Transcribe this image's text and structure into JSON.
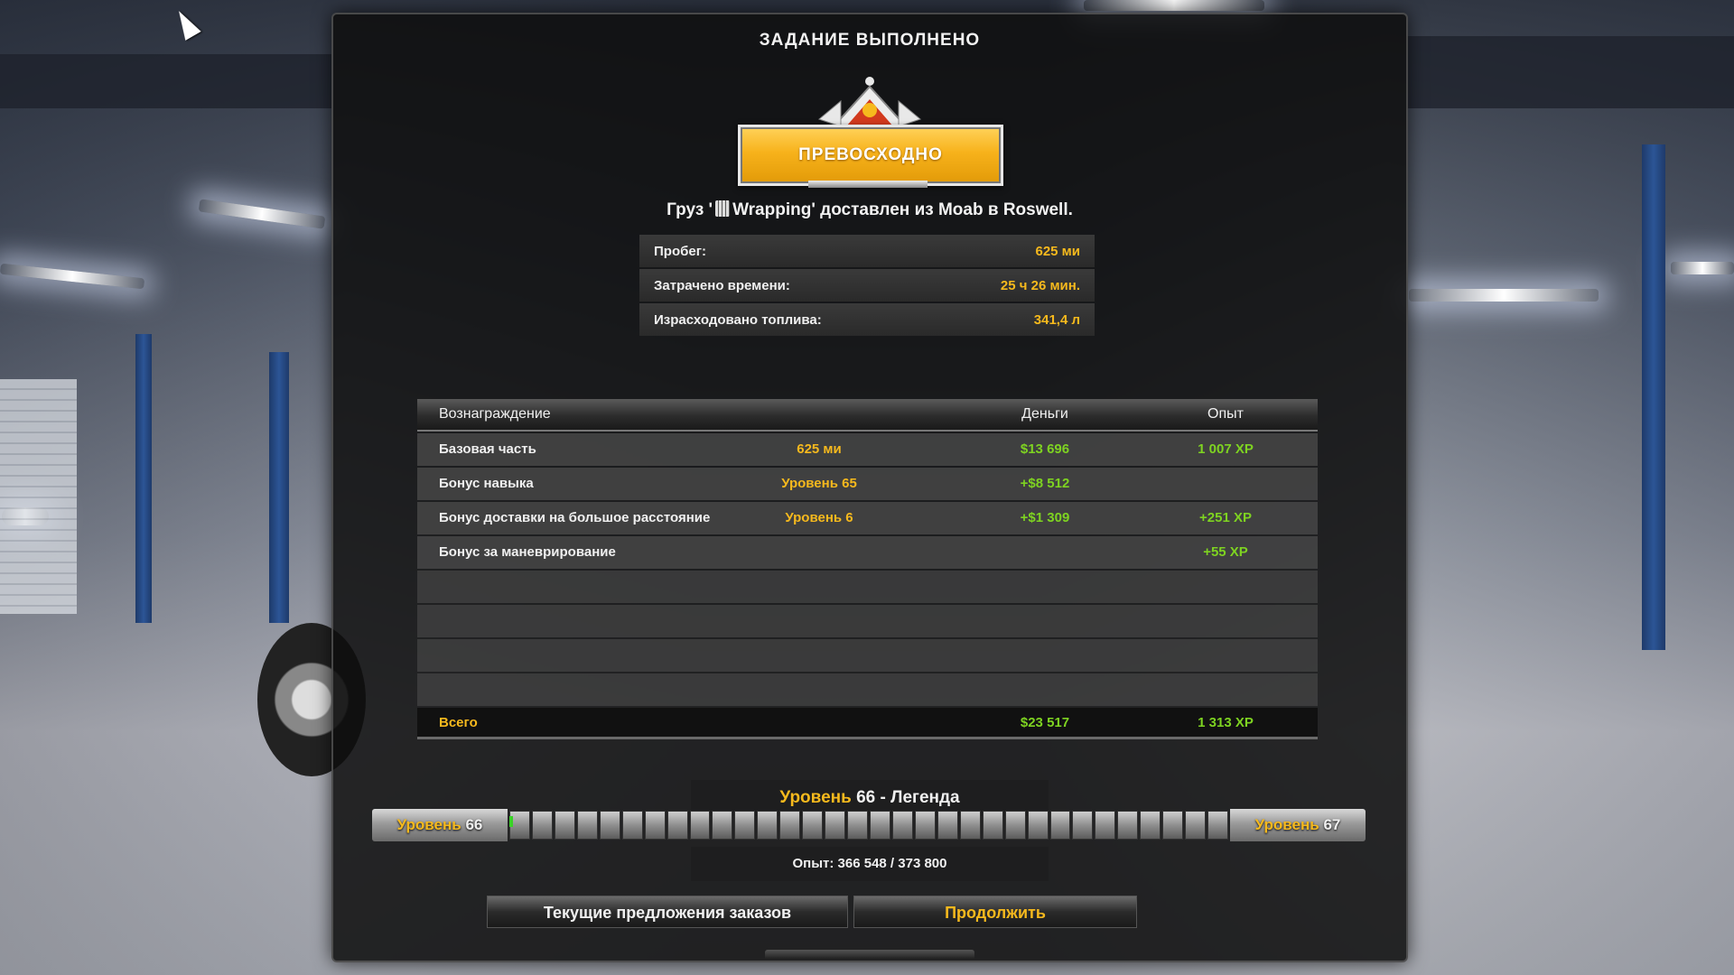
{
  "title": "ЗАДАНИЕ ВЫПОЛНЕНО",
  "rating_label": "ПРЕВОСХОДНО",
  "cargo": {
    "prefix": "Груз '",
    "name": "Wrapping",
    "suffix": "' доставлен из Moab в Roswell.",
    "icon": "cargo-icon"
  },
  "stats": [
    {
      "label": "Пробег:",
      "value": "625 ми"
    },
    {
      "label": "Затрачено времени:",
      "value": "25 ч 26 мин."
    },
    {
      "label": "Израсходовано топлива:",
      "value": "341,4 л"
    }
  ],
  "rewards": {
    "headers": {
      "name": "Вознаграждение",
      "money": "Деньги",
      "xp": "Опыт"
    },
    "rows": [
      {
        "name": "Базовая часть",
        "qty": "625 ми",
        "money": "$13 696",
        "xp": "1 007 XP"
      },
      {
        "name": "Бонус навыка",
        "qty": "Уровень 65",
        "money": "+$8 512",
        "xp": ""
      },
      {
        "name": "Бонус доставки на большое расстояние",
        "qty": "Уровень 6",
        "money": "+$1 309",
        "xp": "+251 XP"
      },
      {
        "name": "Бонус за маневрирование",
        "qty": "",
        "money": "",
        "xp": "+55 XP"
      }
    ],
    "total": {
      "name": "Всего",
      "money": "$23 517",
      "xp": "1 313 XP"
    }
  },
  "level": {
    "word": "Уровень",
    "current": "66",
    "rank": " - Легенда",
    "next": "67",
    "progress_fraction": 0.005
  },
  "xp": "Опыт: 366 548 / 373 800",
  "buttons": {
    "offers": "Текущие предложения заказов",
    "continue": "Продолжить"
  },
  "colors": {
    "accent": "#f6b91d",
    "positive": "#7ed321"
  }
}
